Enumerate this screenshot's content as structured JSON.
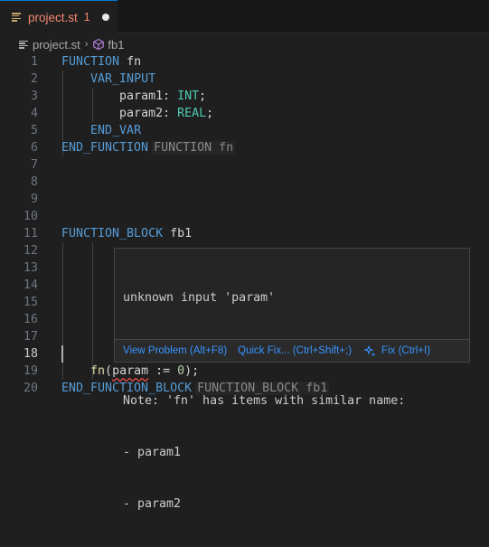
{
  "tab": {
    "label": "project.st",
    "problem_count": "1"
  },
  "breadcrumb": {
    "file": "project.st",
    "separator": "›",
    "symbol": "fb1"
  },
  "lines": [
    {
      "n": "1"
    },
    {
      "n": "2"
    },
    {
      "n": "3"
    },
    {
      "n": "4"
    },
    {
      "n": "5"
    },
    {
      "n": "6"
    },
    {
      "n": "7"
    },
    {
      "n": "8"
    },
    {
      "n": "9"
    },
    {
      "n": "10"
    },
    {
      "n": "11"
    },
    {
      "n": "12"
    },
    {
      "n": "13"
    },
    {
      "n": "14"
    },
    {
      "n": "15"
    },
    {
      "n": "16"
    },
    {
      "n": "17"
    },
    {
      "n": "18"
    },
    {
      "n": "19"
    },
    {
      "n": "20"
    }
  ],
  "code": {
    "l1_kw": "FUNCTION",
    "l1_name": "fn",
    "l2_kw": "VAR_INPUT",
    "l3_name": "param1",
    "l3_colon": ":",
    "l3_type": "INT",
    "l3_semi": ";",
    "l4_name": "param2",
    "l4_colon": ":",
    "l4_type": "REAL",
    "l4_semi": ";",
    "l5_kw": "END_VAR",
    "l6_kw": "END_FUNCTION",
    "l6_hint": "FUNCTION fn",
    "l11_kw": "FUNCTION_BLOCK",
    "l11_name": "fb1",
    "l19_fn": "fn",
    "l19_open": "(",
    "l19_param": "param",
    "l19_assign": " := ",
    "l19_num": "0",
    "l19_close": ");",
    "l20_kw": "END_FUNCTION_BLOCK",
    "l20_hint": "FUNCTION_BLOCK fb1"
  },
  "hover": {
    "message": "unknown input 'param'",
    "note": "Note: 'fn' has items with similar name:",
    "item1": "- param1",
    "item2": "- param2",
    "action_view": "View Problem (Alt+F8)",
    "action_quickfix": "Quick Fix... (Ctrl+Shift+;)",
    "action_fix": "Fix (Ctrl+I)"
  },
  "colors": {
    "error": "#f14c4c",
    "keyword": "#569cd6",
    "type": "#4ec9b0",
    "link": "#3794ff",
    "tab_modified": "#f48771"
  }
}
